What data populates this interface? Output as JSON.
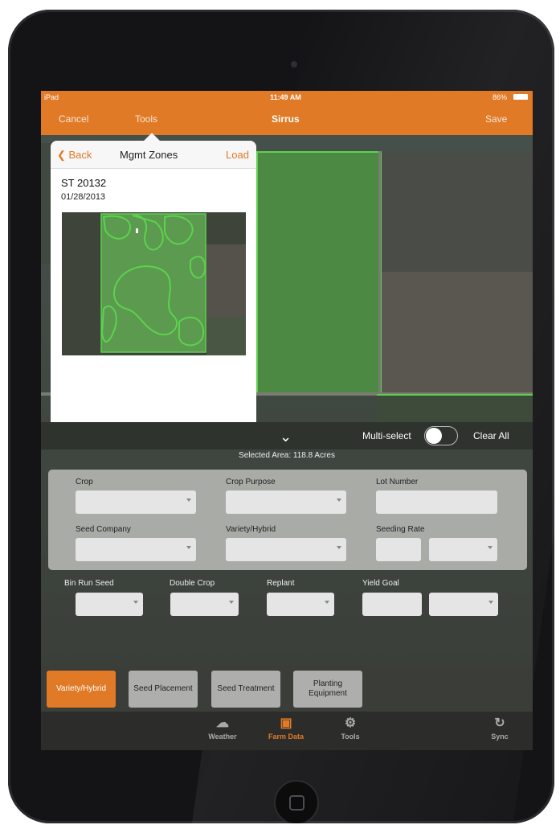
{
  "status_bar": {
    "carrier": "iPad",
    "time": "11:49 AM",
    "battery": "86%"
  },
  "nav": {
    "cancel": "Cancel",
    "tools": "Tools",
    "title": "Sirrus",
    "save": "Save"
  },
  "popover": {
    "back": "Back",
    "title": "Mgmt Zones",
    "load": "Load",
    "field_name": "ST 20132",
    "date": "01/28/2013"
  },
  "controls": {
    "multi_select": "Multi-select",
    "multi_select_on": false,
    "clear_all": "Clear All"
  },
  "selected_area": "Selected Area: 118.8 Acres",
  "form": {
    "crop": "Crop",
    "crop_purpose": "Crop Purpose",
    "lot_number": "Lot Number",
    "seed_company": "Seed Company",
    "variety_hybrid": "Variety/Hybrid",
    "seeding_rate": "Seeding Rate",
    "bin_run_seed": "Bin Run Seed",
    "double_crop": "Double Crop",
    "replant": "Replant",
    "yield_goal": "Yield Goal"
  },
  "tabs": [
    {
      "label": "Variety/Hybrid",
      "active": true
    },
    {
      "label": "Seed Placement",
      "active": false
    },
    {
      "label": "Seed Treatment",
      "active": false
    },
    {
      "label": "Planting Equipment",
      "active": false
    }
  ],
  "tabbar": [
    {
      "label": "Weather",
      "icon": "weather-icon",
      "active": false
    },
    {
      "label": "Farm Data",
      "icon": "farm-data-icon",
      "active": true
    },
    {
      "label": "Tools",
      "icon": "gear-icon",
      "active": false
    },
    {
      "label": "Sync",
      "icon": "sync-icon",
      "active": false
    }
  ],
  "colors": {
    "accent": "#e07a26",
    "zone_outline": "#5dd24e"
  }
}
